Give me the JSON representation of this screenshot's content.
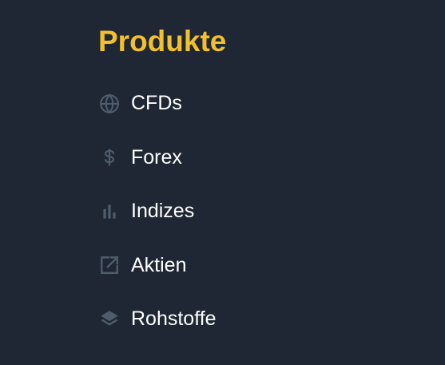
{
  "heading": "Produkte",
  "colors": {
    "background": "#1e2733",
    "heading": "#f2bf2e",
    "icon": "#4e5c6c",
    "text": "#ffffff"
  },
  "menu": {
    "items": [
      {
        "label": "CFDs",
        "icon": "globe-icon"
      },
      {
        "label": "Forex",
        "icon": "dollar-icon"
      },
      {
        "label": "Indizes",
        "icon": "bar-chart-icon"
      },
      {
        "label": "Aktien",
        "icon": "external-link-icon"
      },
      {
        "label": "Rohstoffe",
        "icon": "layers-icon"
      }
    ]
  }
}
